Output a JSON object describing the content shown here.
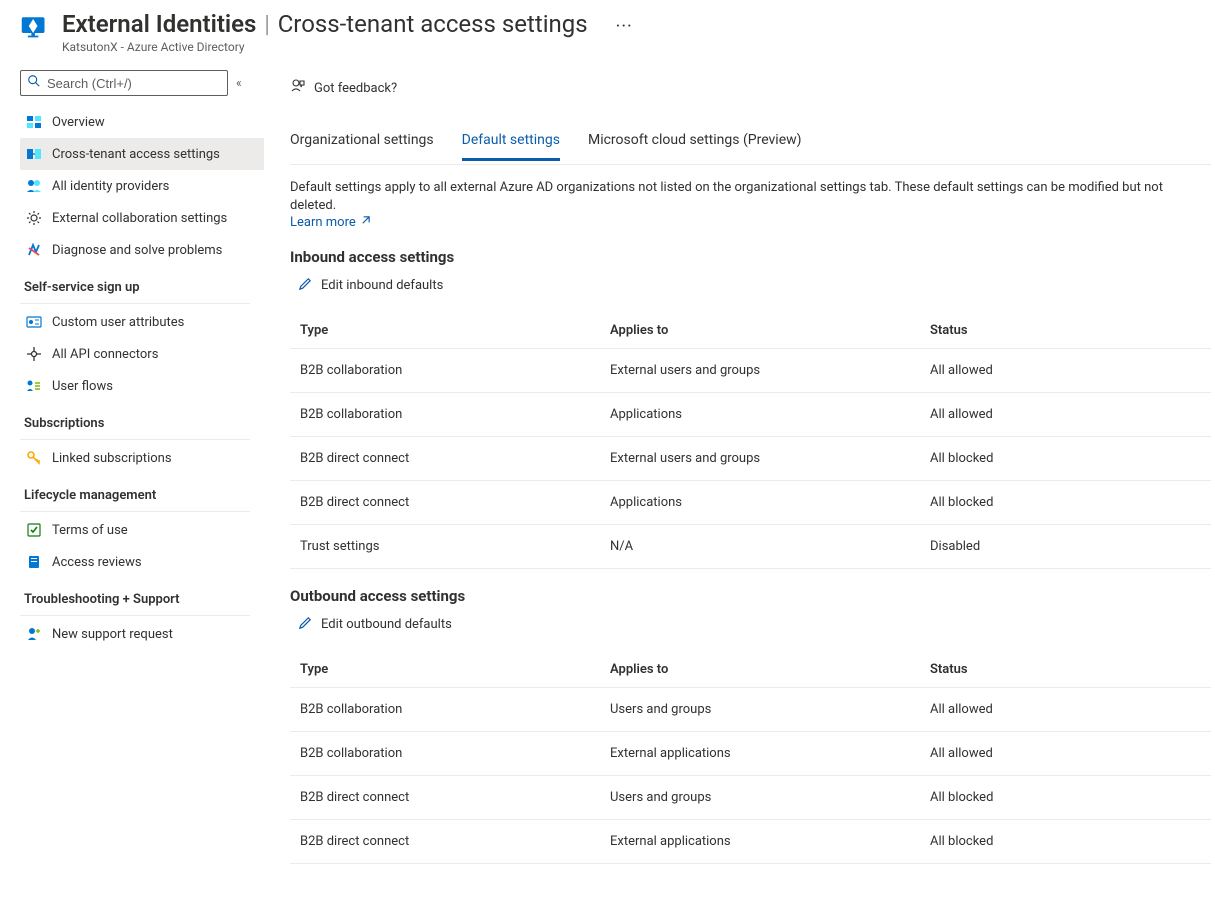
{
  "header": {
    "title": "External Identities",
    "separator": "|",
    "subtitle": "Cross-tenant access settings",
    "more": "···",
    "breadcrumb": "KatsutonX - Azure Active Directory"
  },
  "sidebar": {
    "search_placeholder": "Search (Ctrl+/)",
    "items_top": [
      {
        "id": "overview",
        "label": "Overview"
      },
      {
        "id": "cross-tenant",
        "label": "Cross-tenant access settings"
      },
      {
        "id": "identity-providers",
        "label": "All identity providers"
      },
      {
        "id": "external-collab",
        "label": "External collaboration settings"
      },
      {
        "id": "diagnose",
        "label": "Diagnose and solve problems"
      }
    ],
    "sections": [
      {
        "label": "Self-service sign up",
        "items": [
          {
            "id": "custom-attrs",
            "label": "Custom user attributes"
          },
          {
            "id": "api-connectors",
            "label": "All API connectors"
          },
          {
            "id": "user-flows",
            "label": "User flows"
          }
        ]
      },
      {
        "label": "Subscriptions",
        "items": [
          {
            "id": "linked-subs",
            "label": "Linked subscriptions"
          }
        ]
      },
      {
        "label": "Lifecycle management",
        "items": [
          {
            "id": "terms",
            "label": "Terms of use"
          },
          {
            "id": "reviews",
            "label": "Access reviews"
          }
        ]
      },
      {
        "label": "Troubleshooting + Support",
        "items": [
          {
            "id": "support",
            "label": "New support request"
          }
        ]
      }
    ]
  },
  "main": {
    "feedback_label": "Got feedback?",
    "tabs": [
      {
        "id": "org",
        "label": "Organizational settings"
      },
      {
        "id": "default",
        "label": "Default settings"
      },
      {
        "id": "mscloud",
        "label": "Microsoft cloud settings (Preview)"
      }
    ],
    "active_tab": "default",
    "description": "Default settings apply to all external Azure AD organizations not listed on the organizational settings tab. These default settings can be modified but not deleted.",
    "learn_more": "Learn more",
    "inbound": {
      "title": "Inbound access settings",
      "edit_label": "Edit inbound defaults",
      "columns": {
        "type": "Type",
        "applies": "Applies to",
        "status": "Status"
      },
      "rows": [
        {
          "type": "B2B collaboration",
          "applies": "External users and groups",
          "status": "All allowed"
        },
        {
          "type": "B2B collaboration",
          "applies": "Applications",
          "status": "All allowed"
        },
        {
          "type": "B2B direct connect",
          "applies": "External users and groups",
          "status": "All blocked"
        },
        {
          "type": "B2B direct connect",
          "applies": "Applications",
          "status": "All blocked"
        },
        {
          "type": "Trust settings",
          "applies": "N/A",
          "status": "Disabled"
        }
      ]
    },
    "outbound": {
      "title": "Outbound access settings",
      "edit_label": "Edit outbound defaults",
      "columns": {
        "type": "Type",
        "applies": "Applies to",
        "status": "Status"
      },
      "rows": [
        {
          "type": "B2B collaboration",
          "applies": "Users and groups",
          "status": "All allowed"
        },
        {
          "type": "B2B collaboration",
          "applies": "External applications",
          "status": "All allowed"
        },
        {
          "type": "B2B direct connect",
          "applies": "Users and groups",
          "status": "All blocked"
        },
        {
          "type": "B2B direct connect",
          "applies": "External applications",
          "status": "All blocked"
        }
      ]
    }
  }
}
